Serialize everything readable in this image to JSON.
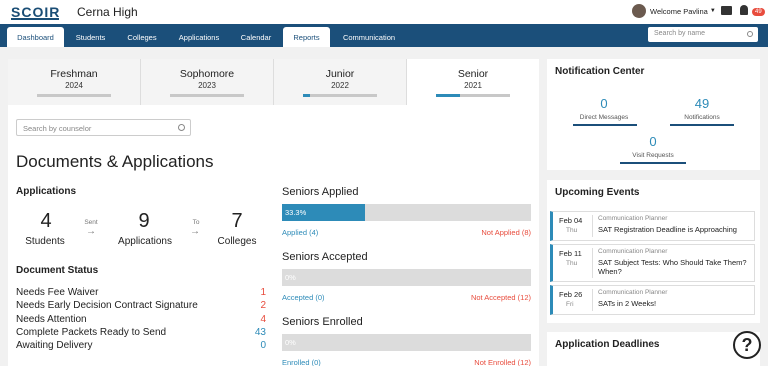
{
  "app": {
    "logo": "SCOIR",
    "school": "Cerna High",
    "welcome": "Welcome Pavlina",
    "badge_count": "49"
  },
  "nav": {
    "tabs": [
      {
        "label": "Dashboard"
      },
      {
        "label": "Students"
      },
      {
        "label": "Colleges"
      },
      {
        "label": "Applications"
      },
      {
        "label": "Calendar"
      },
      {
        "label": "Reports"
      },
      {
        "label": "Communication"
      }
    ],
    "search_placeholder": "Search by name"
  },
  "years": [
    {
      "name": "Freshman",
      "year": "2024",
      "progress": 0
    },
    {
      "name": "Sophomore",
      "year": "2023",
      "progress": 0
    },
    {
      "name": "Junior",
      "year": "2022",
      "progress": 0.1
    },
    {
      "name": "Senior",
      "year": "2021",
      "progress": 0.33
    }
  ],
  "counselor_search_placeholder": "Search by counselor",
  "documents_title": "Documents & Applications",
  "applications": {
    "heading": "Applications",
    "students_num": "4",
    "students_lbl": "Students",
    "sent": "Sent",
    "apps_num": "9",
    "apps_lbl": "Applications",
    "to": "To",
    "colleges_num": "7",
    "colleges_lbl": "Colleges"
  },
  "document_status": {
    "heading": "Document Status",
    "rows": [
      {
        "label": "Needs Fee Waiver",
        "value": "1",
        "color": "#e84c3d"
      },
      {
        "label": "Needs Early Decision Contract Signature",
        "value": "2",
        "color": "#e84c3d"
      },
      {
        "label": "Needs Attention",
        "value": "4",
        "color": "#e84c3d"
      },
      {
        "label": "Complete Packets Ready to Send",
        "value": "43",
        "color": "#2d8bb8"
      },
      {
        "label": "Awaiting Delivery",
        "value": "0",
        "color": "#2d8bb8"
      }
    ]
  },
  "seniors": [
    {
      "heading": "Seniors Applied",
      "pct_label": "33.3%",
      "fraction": 0.333,
      "left": "Applied (4)",
      "right": "Not Applied (8)"
    },
    {
      "heading": "Seniors Accepted",
      "pct_label": "0%",
      "fraction": 0,
      "left": "Accepted (0)",
      "right": "Not Accepted (12)"
    },
    {
      "heading": "Seniors Enrolled",
      "pct_label": "0%",
      "fraction": 0,
      "left": "Enrolled (0)",
      "right": "Not Enrolled (12)"
    }
  ],
  "notifications": {
    "heading": "Notification Center",
    "direct_num": "0",
    "direct_lbl": "Direct Messages",
    "notif_num": "49",
    "notif_lbl": "Notifications",
    "visit_num": "0",
    "visit_lbl": "Visit Requests"
  },
  "events": {
    "heading": "Upcoming Events",
    "items": [
      {
        "date": "Feb 04",
        "day": "Thu",
        "category": "Communication Planner",
        "title": "SAT Registration Deadline is Approaching"
      },
      {
        "date": "Feb 11",
        "day": "Thu",
        "category": "Communication Planner",
        "title": "SAT Subject Tests: Who Should Take Them? When?"
      },
      {
        "date": "Feb 26",
        "day": "Fri",
        "category": "Communication Planner",
        "title": "SATs in 2 Weeks!"
      }
    ]
  },
  "deadlines": {
    "heading": "Application Deadlines"
  },
  "help": "?"
}
